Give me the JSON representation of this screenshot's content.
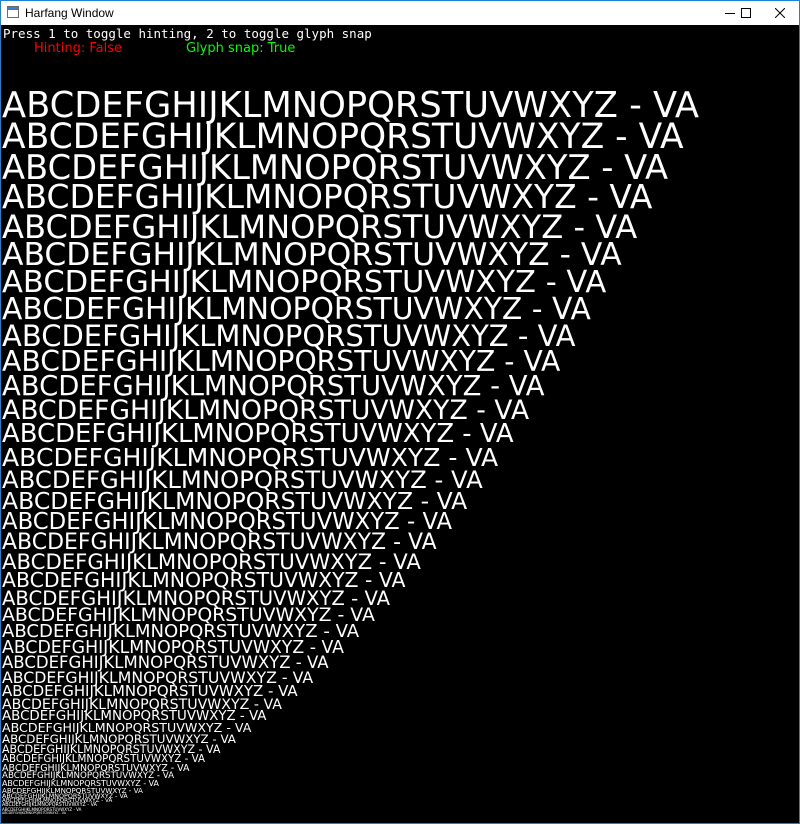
{
  "window": {
    "title": "Harfang Window",
    "controls": {
      "minimize": "minimize-icon",
      "maximize": "maximize-icon",
      "close": "close-icon"
    }
  },
  "app": {
    "instructions": "Press 1 to toggle hinting, 2 to toggle glyph snap",
    "hinting_status": "Hinting: False",
    "glyph_snap_status": "Glyph snap: True",
    "colors": {
      "false_status": "#ff0000",
      "true_status": "#00ff00",
      "background": "#000000",
      "text": "#ffffff"
    }
  },
  "samples": [
    "ABCDEFGHIJKLMNOPQRSTUVWXYZ - VA",
    "ABCDEFGHIJKLMNOPQRSTUVWXYZ - VA",
    "ABCDEFGHIJKLMNOPQRSTUVWXYZ - VA",
    "ABCDEFGHIJKLMNOPQRSTUVWXYZ - VA",
    "ABCDEFGHIJKLMNOPQRSTUVWXYZ - VA",
    "ABCDEFGHIJKLMNOPQRSTUVWXYZ - VA",
    "ABCDEFGHIJKLMNOPQRSTUVWXYZ - VA",
    "ABCDEFGHIJKLMNOPQRSTUVWXYZ - VA",
    "ABCDEFGHIJKLMNOPQRSTUVWXYZ - VA",
    "ABCDEFGHIJKLMNOPQRSTUVWXYZ - VA",
    "ABCDEFGHIJKLMNOPQRSTUVWXYZ - VA",
    "ABCDEFGHIJKLMNOPQRSTUVWXYZ - VA",
    "ABCDEFGHIJKLMNOPQRSTUVWXYZ - VA",
    "ABCDEFGHIJKLMNOPQRSTUVWXYZ - VA",
    "ABCDEFGHIJKLMNOPQRSTUVWXYZ - VA",
    "ABCDEFGHIJKLMNOPQRSTUVWXYZ - VA",
    "ABCDEFGHIJKLMNOPQRSTUVWXYZ - VA",
    "ABCDEFGHIJKLMNOPQRSTUVWXYZ - VA",
    "ABCDEFGHIJKLMNOPQRSTUVWXYZ - VA",
    "ABCDEFGHIJKLMNOPQRSTUVWXYZ - VA",
    "ABCDEFGHIJKLMNOPQRSTUVWXYZ - VA",
    "ABCDEFGHIJKLMNOPQRSTUVWXYZ - VA",
    "ABCDEFGHIJKLMNOPQRSTUVWXYZ - VA",
    "ABCDEFGHIJKLMNOPQRSTUVWXYZ - VA",
    "ABCDEFGHIJKLMNOPQRSTUVWXYZ - VA",
    "ABCDEFGHIJKLMNOPQRSTUVWXYZ - VA",
    "ABCDEFGHIJKLMNOPQRSTUVWXYZ - VA",
    "ABCDEFGHIJKLMNOPQRSTUVWXYZ - VA",
    "ABCDEFGHIJKLMNOPQRSTUVWXYZ - VA",
    "ABCDEFGHIJKLMNOPQRSTUVWXYZ - VA",
    "ABCDEFGHIJKLMNOPQRSTUVWXYZ - VA",
    "ABCDEFGHIJKLMNOPQRSTUVWXYZ - VA",
    "ABCDEFGHIJKLMNOPQRSTUVWXYZ - VA",
    "ABCDEFGHIJKLMNOPQRSTUVWXYZ - VA",
    "ABCDEFGHIJKLMNOPQRSTUVWXYZ - VA",
    "ABCDEFGHIJKLMNOPQRSTUVWXYZ - VA",
    "ABCDEFGHIJKLMNOPQRSTUVWXYZ - VA",
    "ABCDEFGHIJKLMNOPQRSTUVWXYZ - VA",
    "ABCDEFGHIJKLMNOPQRSTUVWXYZ - VA",
    "ABCDEFGHIJKLMNOPQRSTUVWXYZ - VA",
    "ABCDEFGHIJKLMNOPQRSTUVWXYZ - VA",
    "ABCDEFGHIJKLMNOPQRSTUVWXYZ - VA"
  ]
}
